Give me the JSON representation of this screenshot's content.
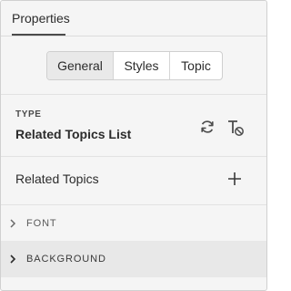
{
  "header": {
    "tab_label": "Properties"
  },
  "segments": {
    "items": [
      "General",
      "Styles",
      "Topic"
    ],
    "selected": "General"
  },
  "type_section": {
    "label": "TYPE",
    "value": "Related Topics List",
    "icons": [
      "refresh-icon",
      "clear-format-icon"
    ]
  },
  "related": {
    "label": "Related Topics",
    "icon": "plus-icon"
  },
  "sections": [
    {
      "label": "FONT",
      "expanded": false
    },
    {
      "label": "BACKGROUND",
      "expanded": false
    }
  ]
}
